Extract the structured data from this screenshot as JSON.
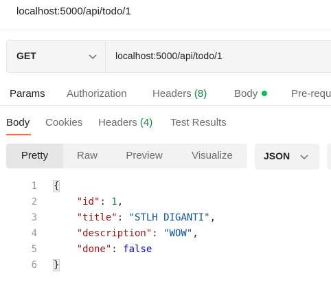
{
  "window": {
    "title": "localhost:5000/api/todo/1"
  },
  "request": {
    "method": "GET",
    "url": "localhost:5000/api/todo/1"
  },
  "request_tabs": [
    {
      "label": "Params"
    },
    {
      "label": "Authorization"
    },
    {
      "label": "Headers",
      "count": "(8)"
    },
    {
      "label": "Body",
      "indicator": "green-dot"
    },
    {
      "label": "Pre-requ"
    }
  ],
  "response_tabs": [
    {
      "label": "Body",
      "active": true
    },
    {
      "label": "Cookies"
    },
    {
      "label": "Headers",
      "count": "(4)"
    },
    {
      "label": "Test Results"
    }
  ],
  "view_modes": [
    {
      "label": "Pretty",
      "active": true
    },
    {
      "label": "Raw"
    },
    {
      "label": "Preview"
    },
    {
      "label": "Visualize"
    }
  ],
  "format": {
    "selected": "JSON"
  },
  "code": {
    "line_numbers": [
      "1",
      "2",
      "3",
      "4",
      "5",
      "6"
    ],
    "open_brace": "{",
    "close_brace": "}",
    "fields": [
      {
        "key": "\"id\"",
        "value": "1",
        "type": "number",
        "trailing": ","
      },
      {
        "key": "\"title\"",
        "value": "\"STLH DIGANTI\"",
        "type": "string",
        "trailing": ","
      },
      {
        "key": "\"description\"",
        "value": "\"WOW\"",
        "type": "string",
        "trailing": ","
      },
      {
        "key": "\"done\"",
        "value": "false",
        "type": "keyword",
        "trailing": ""
      }
    ]
  },
  "colors": {
    "accent": "#ff6c37",
    "count_green": "#0c8a3e",
    "dot_green": "#0cbb52",
    "json_key": "#a31515",
    "json_string": "#0451a5",
    "json_number": "#098658",
    "json_keyword": "#0000ff"
  }
}
